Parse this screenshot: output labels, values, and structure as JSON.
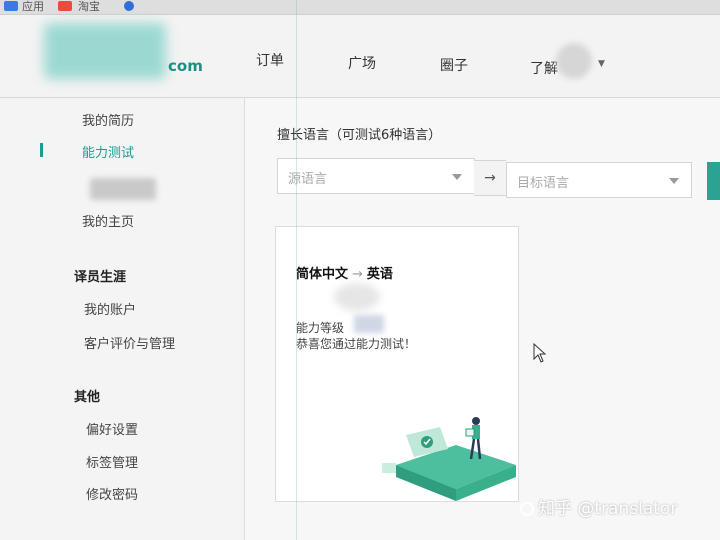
{
  "bookmarks": [
    {
      "label": "应用",
      "icon": "apps-icon",
      "color": "#3b7be0"
    },
    {
      "label": "淘宝",
      "icon": "taobao-icon",
      "color": "#e94b3c"
    },
    {
      "label": "",
      "icon": "ie-icon",
      "color": "#2f6fd8"
    }
  ],
  "header": {
    "logo_suffix": "com",
    "nav": [
      "订单",
      "广场",
      "圈子",
      "了解"
    ],
    "accent": "#1a9c8f"
  },
  "sidebar": {
    "items_top": [
      "我的简历",
      "能力测试",
      "我的主页"
    ],
    "active_item": "能力测试",
    "section_career": {
      "title": "译员生涯",
      "items": [
        "我的账户",
        "客户评价与管理"
      ]
    },
    "section_other": {
      "title": "其他",
      "items": [
        "偏好设置",
        "标签管理",
        "修改密码"
      ]
    }
  },
  "main": {
    "title": "擅长语言（可测试6种语言）",
    "source_placeholder": "源语言",
    "arrow": "→",
    "target_placeholder": "目标语言",
    "card": {
      "source_lang": "简体中文",
      "arrow": "→",
      "target_lang": "英语",
      "level_label": "能力等级",
      "congrats": "恭喜您通过能力测试！"
    }
  },
  "watermark": "知乎 @translator"
}
